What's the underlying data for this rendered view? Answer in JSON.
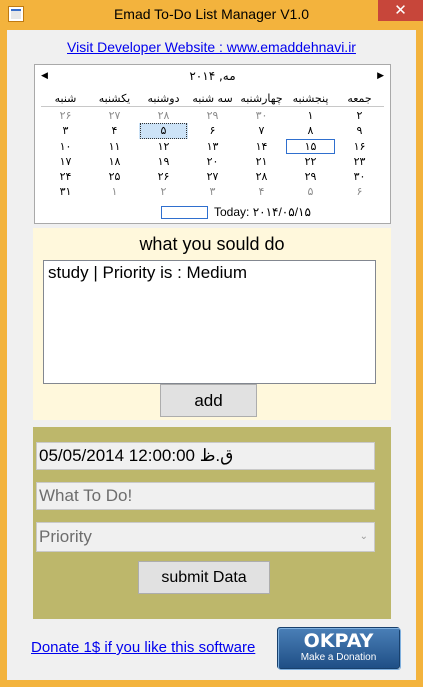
{
  "window": {
    "title": "Emad To-Do List Manager V1.0",
    "close_glyph": "✕"
  },
  "header": {
    "developer_link": "Visit Developer Website : www.emaddehnavi.ir"
  },
  "calendar": {
    "month_label": "مه, ۲۰۱۴",
    "prev_glyph": "◀",
    "next_glyph": "▶",
    "weekdays": [
      "جمعه",
      "پنجشنبه",
      "چهارشنبه",
      "سه شنبه",
      "دوشنبه",
      "یکشنبه",
      "شنبه"
    ],
    "weeks": [
      [
        "۲",
        "۱",
        "۳۰",
        "۲۹",
        "۲۸",
        "۲۷",
        "۲۶"
      ],
      [
        "۹",
        "۸",
        "۷",
        "۶",
        "۵",
        "۴",
        "۳"
      ],
      [
        "۱۶",
        "۱۵",
        "۱۴",
        "۱۳",
        "۱۲",
        "۱۱",
        "۱۰"
      ],
      [
        "۲۳",
        "۲۲",
        "۲۱",
        "۲۰",
        "۱۹",
        "۱۸",
        "۱۷"
      ],
      [
        "۳۰",
        "۲۹",
        "۲۸",
        "۲۷",
        "۲۶",
        "۲۵",
        "۲۴"
      ],
      [
        "۶",
        "۵",
        "۴",
        "۳",
        "۲",
        "۱",
        "۳۱"
      ]
    ],
    "today_label": "Today: ۲۰۱۴/۰۵/۱۵"
  },
  "tasks": {
    "heading": "what you sould do",
    "items": [
      "study | Priority is : Medium"
    ],
    "add_label": "add"
  },
  "form": {
    "date_value": "05/05/2014 12:00:00 ق.ظ",
    "todo_placeholder": "What To Do!",
    "priority_placeholder": "Priority",
    "submit_label": "submit Data"
  },
  "footer": {
    "donate_link": "Donate 1$ if you like this software",
    "okpay_logo": "OKPAY",
    "okpay_caption": "Make a Donation"
  },
  "colors": {
    "titlebar": "#f3b33d",
    "close_button": "#c7463a",
    "task_panel": "#fff8dc",
    "form_panel": "#bdb76b",
    "link": "#0000ee"
  }
}
